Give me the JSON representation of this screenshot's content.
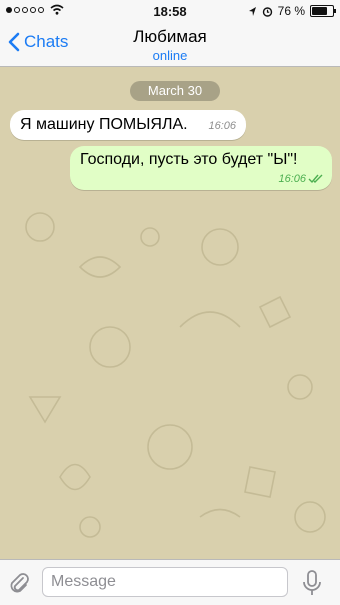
{
  "status_bar": {
    "time": "18:58",
    "battery": "76 %",
    "battery_level": 0.76
  },
  "nav": {
    "back_label": "Chats",
    "title": "Любимая",
    "subtitle": "online"
  },
  "chat": {
    "date": "March 30",
    "messages": [
      {
        "direction": "in",
        "text": "Я машину ПОМЫЯЛА.",
        "time": "16:06"
      },
      {
        "direction": "out",
        "text": "Господи, пусть это будет \"Ы\"!",
        "time": "16:06",
        "read": true
      }
    ]
  },
  "composer": {
    "placeholder": "Message"
  },
  "icons": {
    "back": "chevron-left-icon",
    "attach": "paperclip-icon",
    "mic": "microphone-icon",
    "wifi": "wifi-icon",
    "location": "location-arrow-icon",
    "alarm": "alarm-clock-icon",
    "battery": "battery-icon",
    "read": "double-check-icon"
  },
  "colors": {
    "accent": "#1c7cf4",
    "chat_background": "#d9d0ad",
    "incoming_bubble": "#ffffff",
    "outgoing_bubble": "#e1fec6",
    "read_check": "#4caf50"
  }
}
